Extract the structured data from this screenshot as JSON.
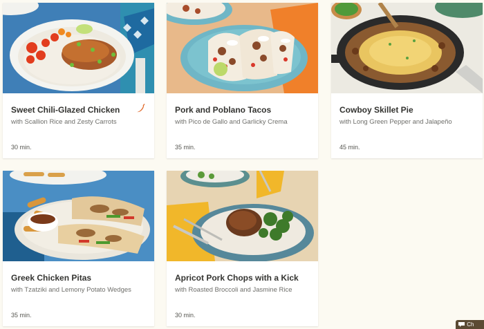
{
  "recipes": [
    {
      "title": "Sweet Chili-Glazed Chicken",
      "subtitle": "with Scallion Rice and Zesty Carrots",
      "time": "30 min.",
      "spicy": true,
      "photo_icon": "chicken-rice-bowl-photo"
    },
    {
      "title": "Pork and Poblano Tacos",
      "subtitle": "with Pico de Gallo and Garlicky Crema",
      "time": "35 min.",
      "spicy": false,
      "photo_icon": "tacos-photo"
    },
    {
      "title": "Cowboy Skillet Pie",
      "subtitle": "with Long Green Pepper and Jalapeño",
      "time": "45 min.",
      "spicy": false,
      "photo_icon": "skillet-pie-photo"
    },
    {
      "title": "Greek Chicken Pitas",
      "subtitle": "with Tzatziki and Lemony Potato Wedges",
      "time": "35 min.",
      "spicy": false,
      "photo_icon": "chicken-pitas-photo"
    },
    {
      "title": "Apricot Pork Chops with a Kick",
      "subtitle": "with Roasted Broccoli and Jasmine Rice",
      "time": "30 min.",
      "spicy": false,
      "photo_icon": "pork-chop-plate-photo"
    }
  ],
  "chat": {
    "label": "Ch",
    "icon": "chat-bubble-icon"
  },
  "colors": {
    "page_bg": "#fcfaf2",
    "title": "#333330",
    "spicy": "#e0692a"
  }
}
